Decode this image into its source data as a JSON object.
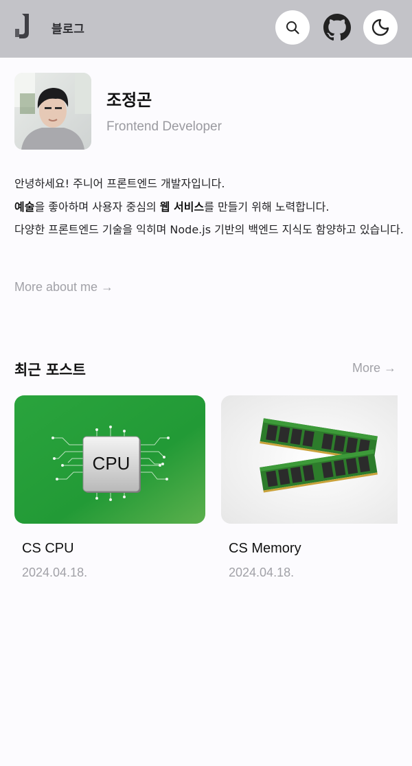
{
  "header": {
    "logo_letter": "J",
    "blog_label": "블로그",
    "buttons": {
      "search": "search-icon",
      "github": "github-icon",
      "theme": "moon-icon"
    }
  },
  "profile": {
    "name": "조정곤",
    "role": "Frontend Developer",
    "intro": {
      "line1": "안녕하세요! 주니어 프론트엔드 개발자입니다.",
      "line2_bold1": "예술",
      "line2_mid": "을 좋아하며 사용자 중심의 ",
      "line2_bold2": "웹 서비스",
      "line2_end": "를 만들기 위해 노력합니다.",
      "line3": "다양한 프론트엔드 기술을 익히며 Node.js 기반의 백엔드 지식도 함양하고 있습니다."
    },
    "more_about": "More about me →"
  },
  "recent_posts": {
    "title": "최근 포스트",
    "more": "More →",
    "items": [
      {
        "title": "CS CPU",
        "date": "2024.04.18.",
        "thumb_label": "CPU"
      },
      {
        "title": "CS Memory",
        "date": "2024.04.18."
      }
    ]
  },
  "colors": {
    "header_bg": "#c3c3c8",
    "page_bg": "#fcfbfe",
    "muted_text": "#a1a1a7",
    "cpu_green": "#2aa43d"
  }
}
